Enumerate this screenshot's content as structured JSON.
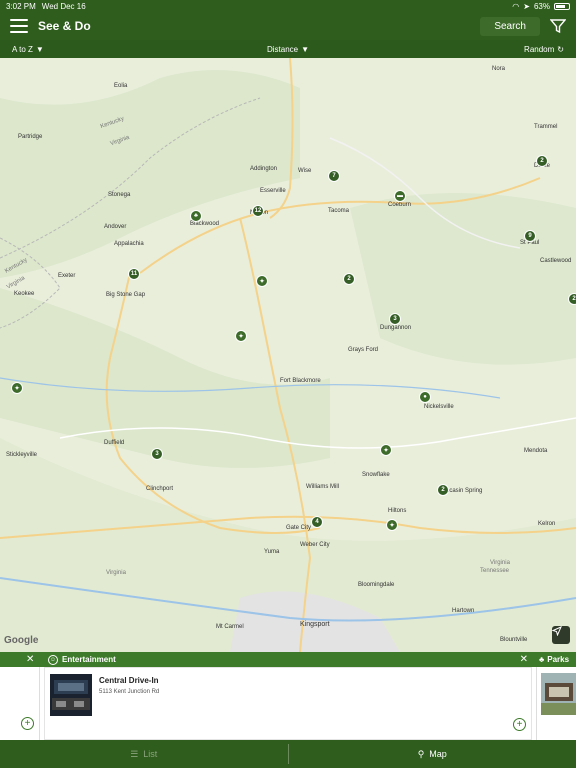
{
  "status_bar": {
    "time": "3:02 PM",
    "date": "Wed Dec 16",
    "battery": "63%"
  },
  "header": {
    "title": "See & Do",
    "search_label": "Search"
  },
  "sort_bar": {
    "az_label": "A to Z",
    "distance_label": "Distance",
    "random_label": "Random"
  },
  "map": {
    "places": [
      "Eolia",
      "Partridge",
      "Kentucky",
      "Virginia",
      "Stonega",
      "Andover",
      "Appalachia",
      "Blackwood",
      "Addington",
      "Wise",
      "Esserville",
      "Norton",
      "Tacoma",
      "Coeburn",
      "Big Stone Gap",
      "Exeter",
      "Keokee",
      "Kentucky",
      "Virginia",
      "Dungannon",
      "Grays Ford",
      "Fort Blackmore",
      "Nickelsville",
      "Duffield",
      "Stickleyville",
      "Clinchport",
      "Williams Mill",
      "Snowflake",
      "Hiltons",
      "Mendota",
      "Gate City",
      "Weber City",
      "Yuma",
      "Virginia",
      "Bloomingdale",
      "Kingsport",
      "Mt Carmel",
      "Hartown",
      "Blountville",
      "Virginia",
      "Tennessee",
      "Kelron",
      "Castlewood",
      "St Paul",
      "Dante",
      "Nora",
      "Trammel",
      "Moccasin Spring"
    ],
    "cluster_counts": [
      "11",
      "12",
      "7",
      "2",
      "3",
      "2",
      "9",
      "2",
      "3",
      "4",
      "2"
    ],
    "google_label": "Google"
  },
  "cards": {
    "left_category": "",
    "main_category": "Entertainment",
    "right_category": "Parks",
    "main_title": "Central Drive-In",
    "main_address": "5113 Kent Junction Rd"
  },
  "tabs": {
    "list_label": "List",
    "map_label": "Map"
  }
}
